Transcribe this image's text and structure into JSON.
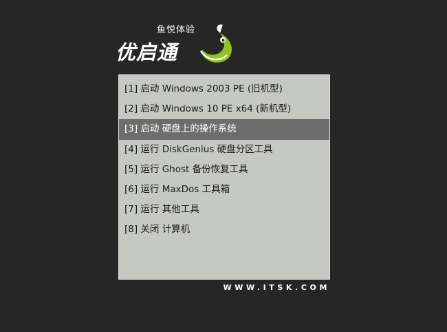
{
  "logo": {
    "tagline": "鱼悦体验",
    "brand": "优启通"
  },
  "menu": {
    "selected_index": 2,
    "items": [
      {
        "label": "[1] 启动 Windows 2003 PE (旧机型)"
      },
      {
        "label": "[2] 启动 Windows 10 PE x64 (新机型)"
      },
      {
        "label": "[3] 启动 硬盘上的操作系统"
      },
      {
        "label": "[4] 运行 DiskGenius 硬盘分区工具"
      },
      {
        "label": "[5] 运行 Ghost 备份恢复工具"
      },
      {
        "label": "[6] 运行 MaxDos 工具箱"
      },
      {
        "label": "[7] 运行 其他工具"
      },
      {
        "label": "[8] 关闭 计算机"
      }
    ]
  },
  "footer": {
    "url": "WWW.ITSK.COM"
  },
  "colors": {
    "background": "#262626",
    "panel": "#c6c8c4",
    "selection": "#6d6d6d",
    "accent_green": "#8fc31f"
  },
  "icons": {
    "logo_mark": "fish-icon"
  }
}
